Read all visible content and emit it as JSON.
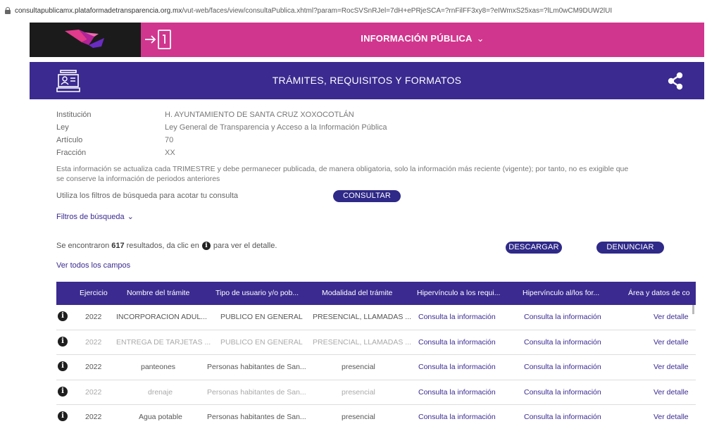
{
  "browser": {
    "url_domain": "consultapublicamx.plataformadetransparencia.org.mx",
    "url_path": "/vut-web/faces/view/consultaPublica.xhtml?param=RocSVSnRJel=7dH+ePRjeSCA=?rnFilFF3xy8=?eIWmxS25xas=?lLm0wCM9DUW2lUI"
  },
  "header": {
    "menu_label": "INFORMACIÓN PÚBLICA",
    "menu_chevron": "⌄"
  },
  "section": {
    "title": "TRÁMITES, REQUISITOS Y FORMATOS"
  },
  "meta": [
    {
      "key": "Institución",
      "value": "H. AYUNTAMIENTO DE SANTA CRUZ XOXOCOTLÁN"
    },
    {
      "key": "Ley",
      "value": "Ley General de Transparencia y Acceso a la Información Pública"
    },
    {
      "key": "Artículo",
      "value": "70"
    },
    {
      "key": "Fracción",
      "value": "XX"
    }
  ],
  "notice": "Esta información se actualiza cada TRIMESTRE y debe permanecer publicada, de manera obligatoria, solo la información más reciente (vigente); por tanto, no es exigible que se conserve la información de periodos anteriores",
  "filters": {
    "hint": "Utiliza los filtros de búsqueda para acotar tu consulta",
    "consultar_label": "CONSULTAR",
    "filtros_label": "Filtros de búsqueda",
    "filtros_chevron": "⌄"
  },
  "results": {
    "prefix": "Se encontraron",
    "count": "617",
    "middle": "resultados, da clic en",
    "suffix": "para ver el detalle.",
    "descargar_label": "DESCARGAR",
    "denunciar_label": "DENUNCIAR",
    "ver_todos": "Ver todos los campos"
  },
  "table": {
    "headers": [
      "Ejercicio",
      "Nombre del trámite",
      "Tipo de usuario y/o pob...",
      "Modalidad del trámite",
      "Hipervínculo a los requi...",
      "Hipervínculo al/los for...",
      "Área y datos de co"
    ],
    "rows": [
      {
        "ejercicio": "2022",
        "nombre": "INCORPORACION ADUL...",
        "tipo": "PUBLICO EN GENERAL",
        "modalidad": "PRESENCIAL, LLAMADAS ...",
        "hiper_req": "Consulta la información",
        "hiper_for": "Consulta la información",
        "area": "Ver detalle"
      },
      {
        "ejercicio": "2022",
        "nombre": "ENTREGA DE TARJETAS ...",
        "tipo": "PUBLICO EN GENERAL",
        "modalidad": "PRESENCIAL, LLAMADAS ...",
        "hiper_req": "Consulta la información",
        "hiper_for": "Consulta la información",
        "area": "Ver detalle"
      },
      {
        "ejercicio": "2022",
        "nombre": "panteones",
        "tipo": "Personas habitantes de San...",
        "modalidad": "presencial",
        "hiper_req": "Consulta la información",
        "hiper_for": "Consulta la información",
        "area": "Ver detalle"
      },
      {
        "ejercicio": "2022",
        "nombre": "drenaje",
        "tipo": "Personas habitantes de San...",
        "modalidad": "presencial",
        "hiper_req": "Consulta la información",
        "hiper_for": "Consulta la información",
        "area": "Ver detalle"
      },
      {
        "ejercicio": "2022",
        "nombre": "Agua potable",
        "tipo": "Personas habitantes de San...",
        "modalidad": "presencial",
        "hiper_req": "Consulta la información",
        "hiper_for": "Consulta la información",
        "area": "Ver detalle"
      }
    ]
  },
  "icons": {
    "info": "i",
    "lock": "lock-icon",
    "logo": "pnt-logo",
    "login": "login-icon",
    "tramites": "id-card-icon",
    "share": "share-icon"
  },
  "colors": {
    "pink": "#d1368e",
    "purple": "#3b2a90",
    "button": "#2f2a88",
    "dark": "#1b1b1b"
  }
}
